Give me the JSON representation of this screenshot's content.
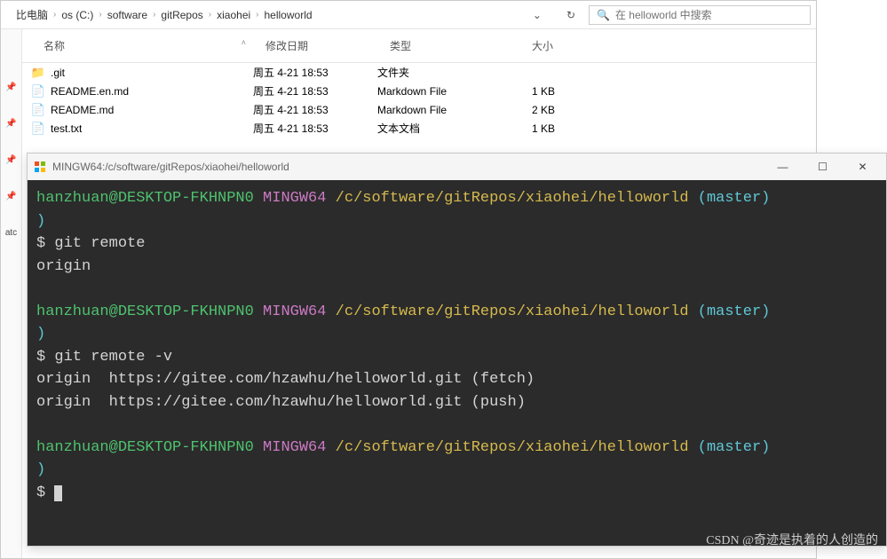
{
  "breadcrumb": [
    "比电脑",
    "os (C:)",
    "software",
    "gitRepos",
    "xiaohei",
    "helloworld"
  ],
  "search": {
    "placeholder": "在 helloworld 中搜索"
  },
  "columns": {
    "name": "名称",
    "date": "修改日期",
    "type": "类型",
    "size": "大小"
  },
  "sidebar_label": "atc",
  "files": [
    {
      "icon": "folder",
      "name": ".git",
      "date": "周五 4-21 18:53",
      "type": "文件夹",
      "size": ""
    },
    {
      "icon": "md",
      "name": "README.en.md",
      "date": "周五 4-21 18:53",
      "type": "Markdown File",
      "size": "1 KB"
    },
    {
      "icon": "md",
      "name": "README.md",
      "date": "周五 4-21 18:53",
      "type": "Markdown File",
      "size": "2 KB"
    },
    {
      "icon": "txt",
      "name": "test.txt",
      "date": "周五 4-21 18:53",
      "type": "文本文档",
      "size": "1 KB"
    }
  ],
  "term_title": "MINGW64:/c/software/gitRepos/xiaohei/helloworld",
  "prompt": {
    "user": "hanzhuan@DESKTOP-FKHNPN0",
    "env": "MINGW64",
    "path": "/c/software/gitRepos/xiaohei/helloworld",
    "branch": "(master)",
    "ps1": "$"
  },
  "session": [
    {
      "cmd": "git remote",
      "output": [
        "origin"
      ]
    },
    {
      "cmd": "git remote -v",
      "output": [
        "origin  https://gitee.com/hzawhu/helloworld.git (fetch)",
        "origin  https://gitee.com/hzawhu/helloworld.git (push)"
      ]
    },
    {
      "cmd": "",
      "output": []
    }
  ],
  "watermark": "CSDN @奇迹是执着的人创造的"
}
